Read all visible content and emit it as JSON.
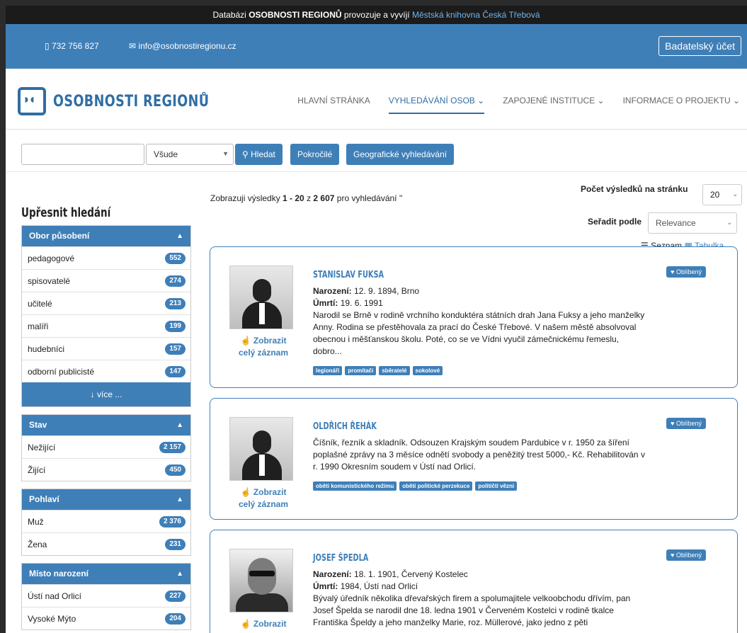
{
  "topbar": {
    "prefix": "Databázi",
    "brand": "OSOBNOSTI REGIONŮ",
    "middle": "provozuje a vyvíjí",
    "library": "Městská knihovna Česká Třebová"
  },
  "contact": {
    "phone": "732 756 827",
    "email": "info@osobnostiregionu.cz",
    "account": "Badatelský účet"
  },
  "logo": {
    "text": "OSOBNOSTI REGIONŮ"
  },
  "menu": [
    {
      "label": "HLAVNÍ STRÁNKA",
      "active": false
    },
    {
      "label": "VYHLEDÁVÁNÍ OSOB ⌄",
      "active": true
    },
    {
      "label": "ZAPOJENÉ INSTITUCE ⌄",
      "active": false
    },
    {
      "label": "INFORMACE O PROJEKTU ⌄",
      "active": false
    }
  ],
  "search": {
    "value": "",
    "scope": "Všude",
    "search_btn": "Hledat",
    "advanced_btn": "Pokročilé",
    "geo_btn": "Geografické vyhledávání"
  },
  "sidebar": {
    "title": "Upřesnit hledání",
    "facets": [
      {
        "title": "Obor působení",
        "items": [
          {
            "label": "pedagogové",
            "count": "552"
          },
          {
            "label": "spisovatelé",
            "count": "274"
          },
          {
            "label": "učitelé",
            "count": "213"
          },
          {
            "label": "malíři",
            "count": "199"
          },
          {
            "label": "hudebníci",
            "count": "157"
          },
          {
            "label": "odborní publicisté",
            "count": "147"
          }
        ],
        "more": "↓ více ..."
      },
      {
        "title": "Stav",
        "items": [
          {
            "label": "Nežijící",
            "count": "2 157"
          },
          {
            "label": "Žijící",
            "count": "450"
          }
        ]
      },
      {
        "title": "Pohlaví",
        "items": [
          {
            "label": "Muž",
            "count": "2 376"
          },
          {
            "label": "Žena",
            "count": "231"
          }
        ]
      },
      {
        "title": "Místo narození",
        "items": [
          {
            "label": "Ústí nad Orlicí",
            "count": "227"
          },
          {
            "label": "Vysoké Mýto",
            "count": "204"
          }
        ]
      }
    ]
  },
  "results": {
    "info_prefix": "Zobrazuji výsledky",
    "range": "1 - 20",
    "info_mid": "z",
    "total": "2 607",
    "info_suffix": "pro vyhledávání ''",
    "per_page_label": "Počet výsledků na stránku",
    "per_page": "20",
    "sort_label": "Seřadit podle",
    "sort": "Relevance",
    "view_list": "Seznam",
    "view_table": "Tabulka"
  },
  "cards": [
    {
      "name": "STANISLAV FUKSA",
      "born_label": "Narození:",
      "born": "12. 9. 1894, Brno",
      "died_label": "Úmrtí:",
      "died": "19. 6. 1991",
      "text": "Narodil se Brně v rodině vrchního konduktéra státních drah Jana Fuksy a jeho manželky Anny. Rodina se přestěhovala za prací do České Třebové. V našem městě absolvoval obecnou i měšťanskou školu. Poté, co se ve Vídni vyučil zámečnickému řemeslu, dobro...",
      "tags": [
        "legionáři",
        "promítači",
        "sběratelé",
        "sokolové"
      ],
      "fav": "Oblíbený",
      "show": "Zobrazit celý záznam"
    },
    {
      "name": "OLDŘICH ŘEHÁK",
      "text": "Číšník, řezník a skladník. Odsouzen Krajským soudem Pardubice v r. 1950 za šíření poplašné zprávy na 3 měsíce odnětí svobody a peněžitý trest 5000,- Kč. Rehabilitován v r. 1990 Okresním soudem v Ústí nad Orlicí.",
      "tags": [
        "oběti komunistického režimu",
        "oběti politické perzekuce",
        "političtí vězni"
      ],
      "fav": "Oblíbený",
      "show": "Zobrazit celý záznam"
    },
    {
      "name": "JOSEF ŠPEDLA",
      "born_label": "Narození:",
      "born": "18. 1. 1901, Červený Kostelec",
      "died_label": "Úmrtí:",
      "died": "1984, Ústí nad Orlicí",
      "text": "Bývalý úředník několika dřevařských firem a spolumajitele velkoobchodu dřívím, pan Josef Špelda se narodil dne 18. ledna 1901 v Červeném Kostelci v rodině tkalce Františka Špeldy a jeho manželky Marie, roz. Müllerové, jako jedno z pěti",
      "fav": "Oblíbený",
      "show": "Zobrazit"
    }
  ]
}
